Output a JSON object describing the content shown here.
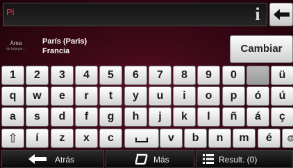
{
  "search": {
    "value": "Pi"
  },
  "area": {
    "label": "Área",
    "sublabel": "de búsque...",
    "city": "París (Paris)",
    "country": "Francia",
    "change_label": "Cambiar"
  },
  "keyboard": {
    "rows": [
      [
        "1",
        "2",
        "3",
        "4",
        "5",
        "6",
        "7",
        "8",
        "9",
        "0",
        "",
        "ü"
      ],
      [
        "q",
        "w",
        "e",
        "r",
        "t",
        "y",
        "u",
        "i",
        "o",
        "p",
        "ó",
        "ú"
      ],
      [
        "a",
        "s",
        "d",
        "f",
        "g",
        "h",
        "j",
        "k",
        "l",
        "ñ",
        "á",
        "ç"
      ],
      [
        "⇧",
        "í",
        "z",
        "x",
        "c",
        "␣",
        "v",
        "b",
        "n",
        "m",
        "é",
        "@ü"
      ]
    ]
  },
  "bottom_bar": {
    "back_label": "Atrás",
    "more_label": "Más",
    "results_label": "Result. (0)"
  },
  "icons": {
    "info": "info-icon",
    "backspace": "backspace-arrow-icon",
    "back": "back-arrow-icon",
    "more": "rounded-square-icon",
    "results": "list-icon"
  },
  "colors": {
    "search_text": "#ff2e3e",
    "background": "#3a0816"
  }
}
